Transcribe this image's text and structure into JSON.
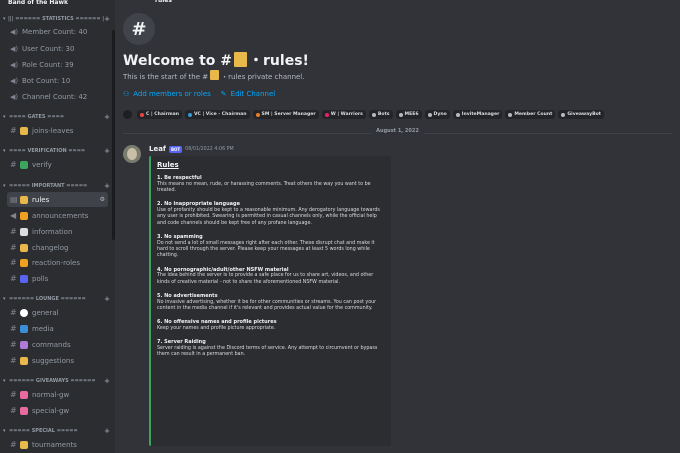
{
  "server": {
    "name": "Band of the Hawk"
  },
  "sidebar": {
    "categories": [
      {
        "label": "||| ====== STATISTICS ====== |"
      },
      {
        "label": "==== GATES ===="
      },
      {
        "label": "==== VERIFICATION ===="
      },
      {
        "label": "===== IMPORTANT ====="
      },
      {
        "label": "====== LOUNGE ======"
      },
      {
        "label": "====== GIVEAWAYS ======"
      },
      {
        "label": "===== SPECIAL ====="
      }
    ],
    "stats": [
      {
        "label": "Member Count: 40"
      },
      {
        "label": "User Count: 30"
      },
      {
        "label": "Role Count: 39"
      },
      {
        "label": "Bot Count: 10"
      },
      {
        "label": "Channel Count: 42"
      }
    ],
    "channels": [
      {
        "label": "joins-leaves",
        "emoji_color": "#e8b84a"
      },
      {
        "label": "verify",
        "emoji_color": "#3ba55d"
      },
      {
        "label": "rules",
        "emoji_color": "#e8b84a",
        "active": true
      },
      {
        "label": "announcements",
        "emoji_color": "#f0a020"
      },
      {
        "label": "information",
        "emoji_color": "#dddddd"
      },
      {
        "label": "changelog",
        "emoji_color": "#e8b84a"
      },
      {
        "label": "reaction-roles",
        "emoji_color": "#f0a020"
      },
      {
        "label": "polls",
        "emoji_color": "#5865f2"
      },
      {
        "label": "general",
        "emoji_color": "#ffffff"
      },
      {
        "label": "media",
        "emoji_color": "#3a8fd8"
      },
      {
        "label": "commands",
        "emoji_color": "#b07bd8"
      },
      {
        "label": "suggestions",
        "emoji_color": "#e8b84a"
      },
      {
        "label": "normal-gw",
        "emoji_color": "#e86aa0"
      },
      {
        "label": "special-gw",
        "emoji_color": "#e86aa0"
      },
      {
        "label": "tournaments",
        "emoji_color": "#e8b84a"
      }
    ]
  },
  "header": {
    "channel_name": "rules"
  },
  "welcome": {
    "title_prefix": "Welcome to #",
    "title_suffix": "・rules!",
    "sub_prefix": "This is the start of the #",
    "sub_suffix": "・rules private channel.",
    "add_members": "Add members or roles",
    "edit_channel": "Edit Channel"
  },
  "roles": [
    {
      "label": "C | Chairman",
      "color": "#ed4245"
    },
    {
      "label": "VC | Vice - Chairman",
      "color": "#3498db"
    },
    {
      "label": "SM | Server Manager",
      "color": "#e67e22"
    },
    {
      "label": "W | Warriors",
      "color": "#e91e63"
    },
    {
      "label": "Bots",
      "color": "#b5bac1"
    },
    {
      "label": "MEE6",
      "color": "#b5bac1"
    },
    {
      "label": "Dyno",
      "color": "#b5bac1"
    },
    {
      "label": "InviteManager",
      "color": "#b5bac1"
    },
    {
      "label": "Member Count",
      "color": "#b5bac1"
    },
    {
      "label": "GiveawayBot",
      "color": "#b5bac1"
    }
  ],
  "divider_date": "August 1, 2022",
  "message": {
    "author": "Leaf",
    "bot_tag": "BOT",
    "timestamp": "08/01/2022 4:06 PM",
    "embed_title": "Rules",
    "rules": [
      {
        "head": "1. Be respectful",
        "body": "This means no mean, rude, or harassing comments. Treat others the way you want to be treated."
      },
      {
        "head": "2. No inappropriate language",
        "body": "Use of profanity should be kept to a reasonable minimum. Any derogatory language towards any user is prohibited. Swearing is permitted in casual channels only, while the official help and code channels should be kept free of any profane language."
      },
      {
        "head": "3. No spamming",
        "body": "Do not send a lot of small messages right after each other. These disrupt chat and make it hard to scroll through the server. Please keep your messages at least 5 words long while chatting."
      },
      {
        "head": "4. No pornographic/adult/other NSFW material",
        "body": "The idea behind the server is to provide a safe place for us to share art, videos, and other kinds of creative material - not to share the aforementioned NSFW material."
      },
      {
        "head": "5. No advertisements",
        "body": "No invasive advertising, whether it be for other communities or streams. You can post your content in the media channel if it's relevant and provides actual value for the community."
      },
      {
        "head": "6. No offensive names and profile pictures",
        "body": "Keep your names and profile picture appropriate."
      },
      {
        "head": "7. Server Raiding",
        "body": "Server raiding is against the Discord terms of service. Any attempt to circumvent or bypass them can result in a permanent ban."
      }
    ]
  }
}
